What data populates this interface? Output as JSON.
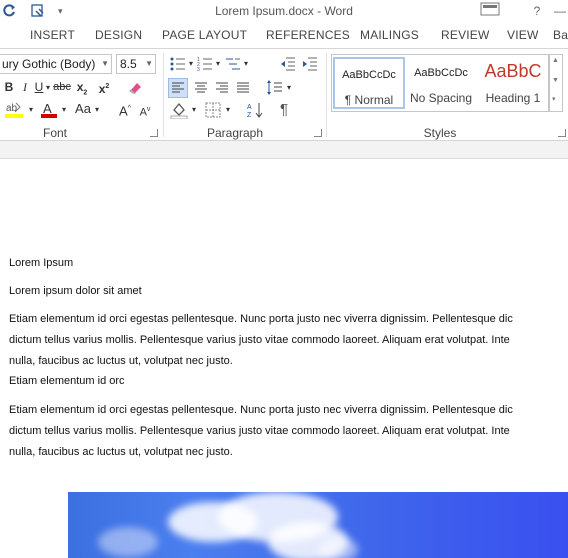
{
  "window": {
    "title": "Lorem Ipsum.docx - Word",
    "help_label": "?",
    "minimize_label": "—"
  },
  "tabs": [
    {
      "label": "INSERT"
    },
    {
      "label": "DESIGN"
    },
    {
      "label": "PAGE LAYOUT"
    },
    {
      "label": "REFERENCES"
    },
    {
      "label": "MAILINGS"
    },
    {
      "label": "REVIEW"
    },
    {
      "label": "VIEW"
    },
    {
      "label": "Ba"
    }
  ],
  "font_group": {
    "label": "Font",
    "font_name": "ury Gothic (Body)",
    "font_size": "8.5",
    "bold": "B",
    "italic": "I",
    "underline": "U",
    "strikethrough": "abc",
    "subscript": "x",
    "subscript_mark": "2",
    "superscript": "x",
    "superscript_mark": "2",
    "grow_font": "A",
    "shrink_font": "A",
    "change_case": "Aa"
  },
  "paragraph_group": {
    "label": "Paragraph"
  },
  "styles_group": {
    "label": "Styles",
    "items": [
      {
        "sample": "AaBbCcDc",
        "name": "¶ Normal"
      },
      {
        "sample": "AaBbCcDc",
        "name": "No Spacing"
      },
      {
        "sample": "AaBbC",
        "name": "Heading 1"
      }
    ]
  },
  "colors": {
    "accent": "#2b579a",
    "highlight": "#ffff00",
    "font_color": "#d00000",
    "heading_red": "#c0392b"
  },
  "document": {
    "paragraphs": [
      {
        "lines": [
          "Lorem Ipsum"
        ]
      },
      {
        "lines": [
          "Lorem ipsum dolor sit amet"
        ]
      },
      {
        "lines": [
          "Etiam elementum id orci egestas pellentesque. Nunc porta justo nec viverra dignissim. Pellentesque dic",
          "dictum tellus varius mollis. Pellentesque varius justo vitae commodo laoreet. Aliquam erat volutpat. Inte",
          "nulla, faucibus ac luctus ut, volutpat nec justo."
        ]
      },
      {
        "lines": [
          "Etiam elementum id orc"
        ]
      },
      {
        "lines": [
          "Etiam elementum id orci egestas pellentesque. Nunc porta justo nec viverra dignissim. Pellentesque dic",
          "dictum tellus varius mollis. Pellentesque varius justo vitae commodo laoreet. Aliquam erat volutpat. Inte",
          "nulla, faucibus ac luctus ut, volutpat nec justo."
        ]
      }
    ]
  }
}
